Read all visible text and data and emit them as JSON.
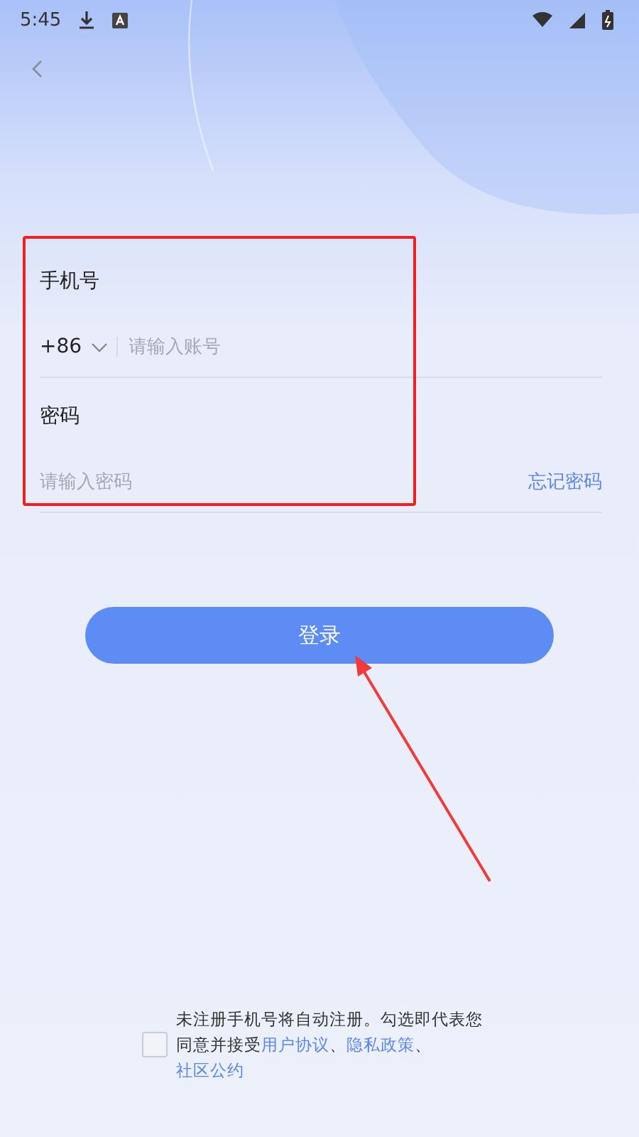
{
  "status_bar": {
    "time": "5:45"
  },
  "phone": {
    "label": "手机号",
    "country_code": "+86",
    "placeholder": "请输入账号"
  },
  "password": {
    "label": "密码",
    "placeholder": "请输入密码",
    "forgot_link": "忘记密码"
  },
  "login_button": "登录",
  "agreement": {
    "checked": false,
    "parts": [
      {
        "kind": "text",
        "text": "未注册手机号将自动注册。勾选即代表您同意并接受"
      },
      {
        "kind": "link",
        "text": "用户协议"
      },
      {
        "kind": "text",
        "text": "、"
      },
      {
        "kind": "link",
        "text": "隐私政策"
      },
      {
        "kind": "text",
        "text": "、"
      },
      {
        "kind": "link",
        "text": "社区公约"
      }
    ]
  }
}
